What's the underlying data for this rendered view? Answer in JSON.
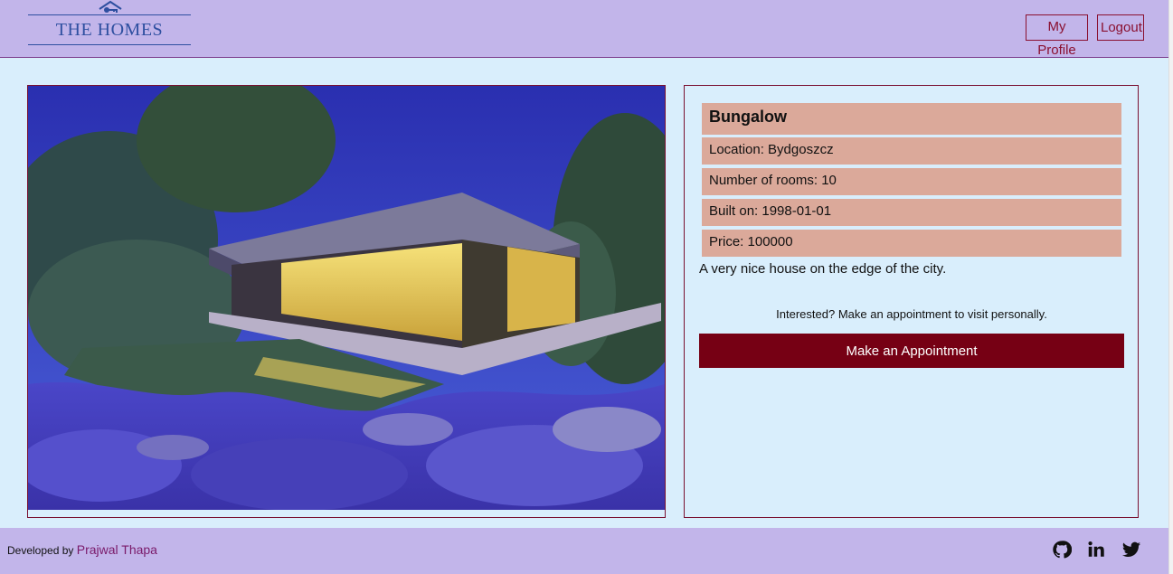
{
  "header": {
    "logo_text": "THE HOMES",
    "nav": {
      "profile_label": "My Profile",
      "logout_label": "Logout"
    }
  },
  "property": {
    "title": "Bungalow",
    "location": "Location: Bydgoszcz",
    "rooms": "Number of rooms: 10",
    "built": "Built on: 1998-01-01",
    "price": "Price: 100000",
    "description": "A very nice house on the edge of the city."
  },
  "appointment": {
    "prompt": "Interested? Make an appointment to visit personally.",
    "button_label": "Make an Appointment"
  },
  "footer": {
    "developed_by": "Developed by",
    "developer_name": "Prajwal Thapa",
    "social_icons": [
      "github-icon",
      "linkedin-icon",
      "twitter-icon"
    ]
  },
  "colors": {
    "header_bg": "#c2b5ea",
    "page_bg": "#d9eefc",
    "info_row_bg": "#dba99a",
    "accent": "#760014"
  }
}
